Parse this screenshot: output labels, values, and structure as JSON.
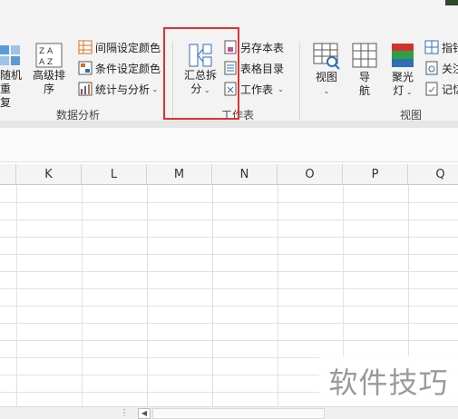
{
  "ribbon": {
    "data_analysis": {
      "partial_label_1": "随机重",
      "partial_label_2": "复",
      "sort_label_1": "高级排",
      "sort_label_2": "序",
      "interval_color": "间隔设定颜色",
      "conditional_color": "条件设定颜色",
      "stats_analysis": "统计与分析",
      "group_label": "数据分析"
    },
    "worksheet": {
      "summary_split_1": "汇总拆",
      "summary_split_2": "分",
      "save_copy": "另存本表",
      "table_toc": "表格目录",
      "worksheet_menu": "工作表",
      "group_label": "工作表"
    },
    "view": {
      "view_label": "视图",
      "nav_label_1": "导",
      "nav_label_2": "航",
      "spotlight_1": "聚光",
      "spotlight_2": "灯",
      "pointer": "指针",
      "follow": "关注",
      "memo": "记忆",
      "group_label": "视图"
    },
    "colors": {
      "highlight_box": "#e0312e",
      "icon_blue": "#2f6fb5",
      "icon_orange": "#d86f1e"
    }
  },
  "grid": {
    "columns": [
      "K",
      "L",
      "M",
      "N",
      "O",
      "P",
      "Q"
    ]
  },
  "watermark": {
    "text": "软件技巧"
  }
}
